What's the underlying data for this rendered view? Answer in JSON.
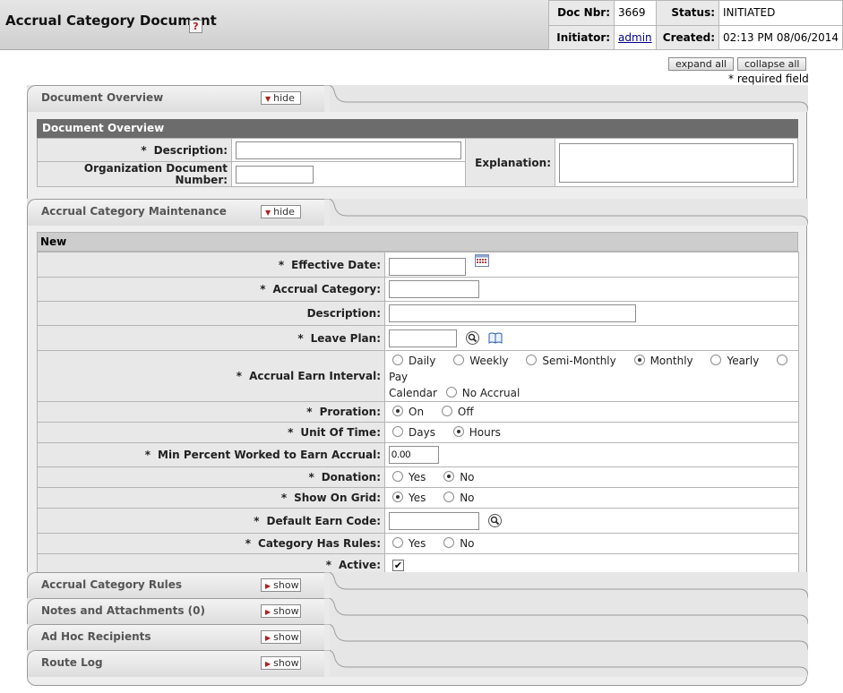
{
  "header": {
    "title": "Accrual Category Document",
    "help_icon": "?",
    "doc_nbr_label": "Doc Nbr:",
    "doc_nbr": "3669",
    "status_label": "Status:",
    "status": "INITIATED",
    "initiator_label": "Initiator:",
    "initiator": "admin",
    "created_label": "Created:",
    "created": "02:13 PM 08/06/2014"
  },
  "controls": {
    "expand_all": "expand all",
    "collapse_all": "collapse all",
    "required_note": "* required field"
  },
  "tabs": {
    "overview": {
      "title": "Document Overview",
      "button": "hide"
    },
    "maintenance": {
      "title": "Accrual Category Maintenance",
      "button": "hide"
    },
    "rules": {
      "title": "Accrual Category Rules",
      "button": "show"
    },
    "notes": {
      "title": "Notes and Attachments (0)",
      "button": "show"
    },
    "adhoc": {
      "title": "Ad Hoc Recipients",
      "button": "show"
    },
    "routelog": {
      "title": "Route Log",
      "button": "show"
    }
  },
  "overview": {
    "section_title": "Document Overview",
    "description_label": "Description:",
    "description_value": "",
    "org_doc_number_label_1": "Organization Document",
    "org_doc_number_label_2": "Number:",
    "org_doc_number_value": "",
    "explanation_label": "Explanation:",
    "explanation_value": ""
  },
  "maintenance": {
    "section_title": "New",
    "asterisk": "*",
    "effective_date_label": "Effective Date:",
    "effective_date_value": "",
    "accrual_category_label": "Accrual Category:",
    "accrual_category_value": "",
    "description_label": "Description:",
    "description_value": "",
    "leave_plan_label": "Leave Plan:",
    "leave_plan_value": "",
    "earn_interval_label": "Accrual Earn Interval:",
    "earn_interval_options": [
      "Daily",
      "Weekly",
      "Semi-Monthly",
      "Monthly",
      "Yearly",
      "Pay Calendar",
      "No Accrual"
    ],
    "earn_interval_pay_1": "Pay",
    "earn_interval_pay_2": "Calendar",
    "earn_interval_selected": "Monthly",
    "proration_label": "Proration:",
    "proration_options": [
      "On",
      "Off"
    ],
    "proration_selected": "On",
    "unit_of_time_label": "Unit Of Time:",
    "unit_of_time_options": [
      "Days",
      "Hours"
    ],
    "unit_of_time_selected": "Hours",
    "min_percent_label": "Min Percent Worked to Earn Accrual:",
    "min_percent_value": "0.00",
    "donation_label": "Donation:",
    "donation_options": [
      "Yes",
      "No"
    ],
    "donation_selected": "No",
    "show_on_grid_label": "Show On Grid:",
    "show_on_grid_options": [
      "Yes",
      "No"
    ],
    "show_on_grid_selected": "Yes",
    "default_earn_code_label": "Default Earn Code:",
    "default_earn_code_value": "",
    "has_rules_label": "Category Has Rules:",
    "has_rules_options": [
      "Yes",
      "No"
    ],
    "has_rules_selected": "none",
    "active_label": "Active:",
    "active_checked": true,
    "active_mark": "✔"
  },
  "icons": {
    "calendar": "calendar-icon",
    "lookup": "magnifier-icon",
    "inquiry": "book-icon",
    "hide_triangle": "triangle-down",
    "show_triangle": "triangle-right"
  },
  "glyphs": {
    "tri_down": "▼",
    "tri_right": "▶"
  }
}
